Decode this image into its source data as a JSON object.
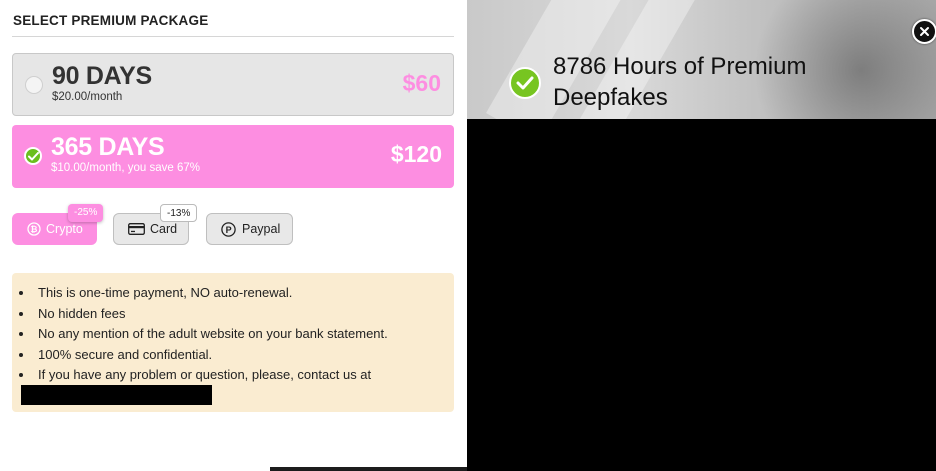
{
  "modal": {
    "heading": "SELECT PREMIUM PACKAGE",
    "packages": [
      {
        "title": "90 DAYS",
        "subtitle": "$20.00/month",
        "price": "$60",
        "selected": false
      },
      {
        "title": "365 DAYS",
        "subtitle": "$10.00/month, you save 67%",
        "price": "$120",
        "selected": true
      }
    ],
    "payment_methods": [
      {
        "label": "Crypto",
        "badge": "-25%",
        "icon": "bitcoin-icon",
        "selected": true
      },
      {
        "label": "Card",
        "badge": "-13%",
        "icon": "credit-card-icon",
        "selected": false
      },
      {
        "label": "Paypal",
        "badge": "",
        "icon": "paypal-icon",
        "selected": false
      }
    ],
    "notes": [
      "This is one-time payment, NO auto-renewal.",
      "No hidden fees",
      "No any mention of the adult website on your bank statement.",
      "100% secure and confidential.",
      "If you have any problem or question, please, contact us at"
    ]
  },
  "promo": {
    "headline": "8786 Hours of Premium Deepfakes",
    "icon": "check-circle-icon"
  },
  "close_icon": "close-icon",
  "colors": {
    "accent_pink": "#fd8ee1",
    "check_green": "#6bbf1e",
    "notes_bg": "#faecd1",
    "package_gray": "#e6e6e6"
  }
}
